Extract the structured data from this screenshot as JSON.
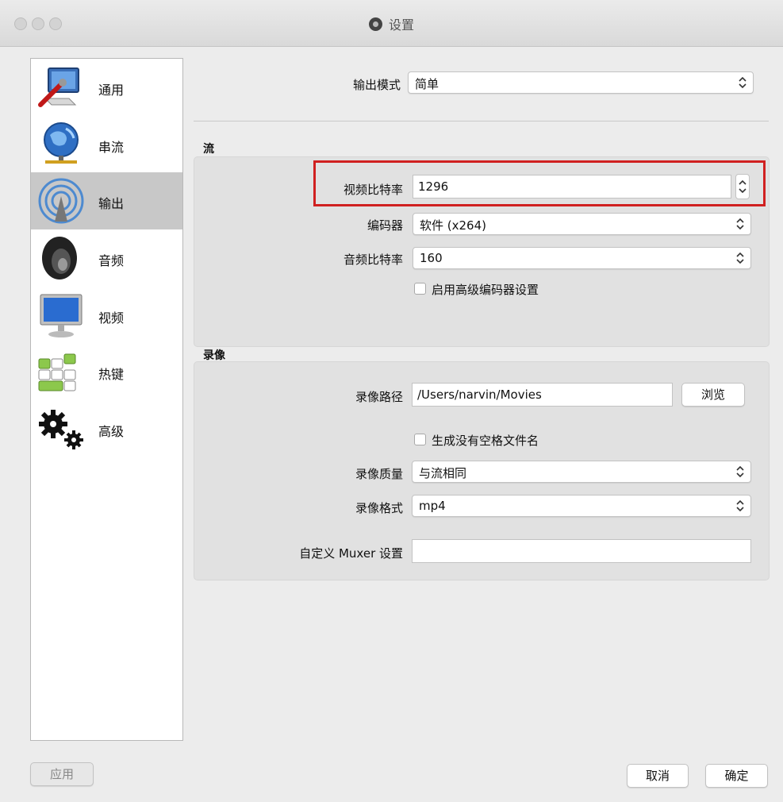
{
  "window": {
    "title": "设置"
  },
  "sidebar": {
    "items": [
      {
        "label": "通用",
        "icon": "general-settings-icon"
      },
      {
        "label": "串流",
        "icon": "globe-network-icon"
      },
      {
        "label": "输出",
        "icon": "broadcast-output-icon",
        "selected": true
      },
      {
        "label": "音频",
        "icon": "speaker-icon"
      },
      {
        "label": "视频",
        "icon": "monitor-icon"
      },
      {
        "label": "热键",
        "icon": "keyboard-icon"
      },
      {
        "label": "高级",
        "icon": "gears-icon"
      }
    ]
  },
  "output_mode": {
    "label": "输出模式",
    "value": "简单"
  },
  "stream": {
    "section_title": "流",
    "video_bitrate": {
      "label": "视频比特率",
      "value": "1296"
    },
    "encoder": {
      "label": "编码器",
      "value": "软件 (x264)"
    },
    "audio_bitrate": {
      "label": "音频比特率",
      "value": "160"
    },
    "advanced_encoder": {
      "label": "启用高级编码器设置",
      "checked": false
    }
  },
  "recording": {
    "section_title": "录像",
    "path": {
      "label": "录像路径",
      "value": "/Users/narvin/Movies",
      "browse_label": "浏览"
    },
    "no_space_filename": {
      "label": "生成没有空格文件名",
      "checked": false
    },
    "quality": {
      "label": "录像质量",
      "value": "与流相同"
    },
    "format": {
      "label": "录像格式",
      "value": "mp4"
    },
    "muxer": {
      "label": "自定义 Muxer 设置",
      "value": ""
    }
  },
  "buttons": {
    "apply": "应用",
    "cancel": "取消",
    "ok": "确定"
  },
  "colors": {
    "highlight": "#d02020",
    "selected": "#c8c8c8"
  }
}
